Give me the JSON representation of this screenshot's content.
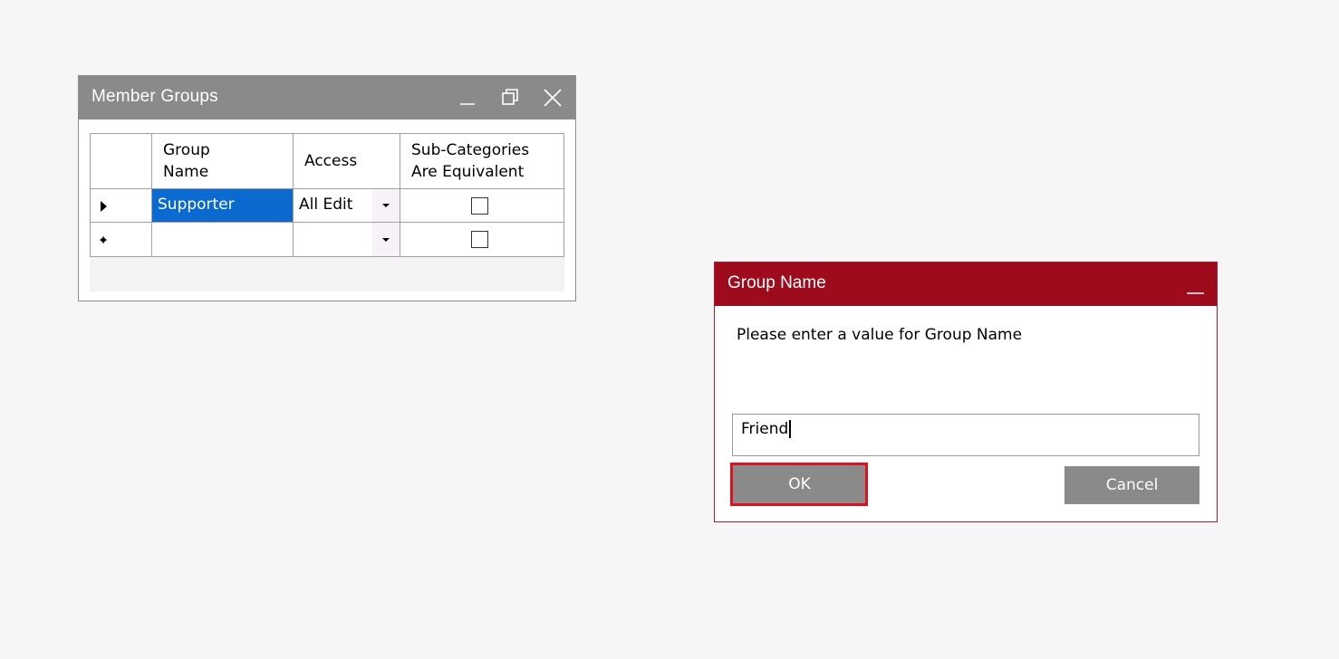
{
  "member_groups": {
    "title": "Member Groups",
    "columns": {
      "group_name_line1": "Group",
      "group_name_line2": "Name",
      "access": "Access",
      "sub_categories_line1": "Sub-Categories",
      "sub_categories_line2": "Are Equivalent"
    },
    "rows": [
      {
        "indicator": "current-row-arrow",
        "group_name": "Supporter",
        "access": "All Edit",
        "sub_categories_equivalent": false
      },
      {
        "indicator": "new-row-asterisk",
        "group_name": "",
        "access": "",
        "sub_categories_equivalent": false
      }
    ]
  },
  "group_name_dialog": {
    "title": "Group Name",
    "prompt": "Please enter a value for Group Name",
    "input_value": "Friend",
    "ok_label": "OK",
    "cancel_label": "Cancel"
  },
  "colors": {
    "gray_titlebar": "#8a8a8a",
    "dialog_titlebar": "#9e0b1d",
    "selection": "#0a6ad0",
    "highlight": "#e0101f"
  }
}
